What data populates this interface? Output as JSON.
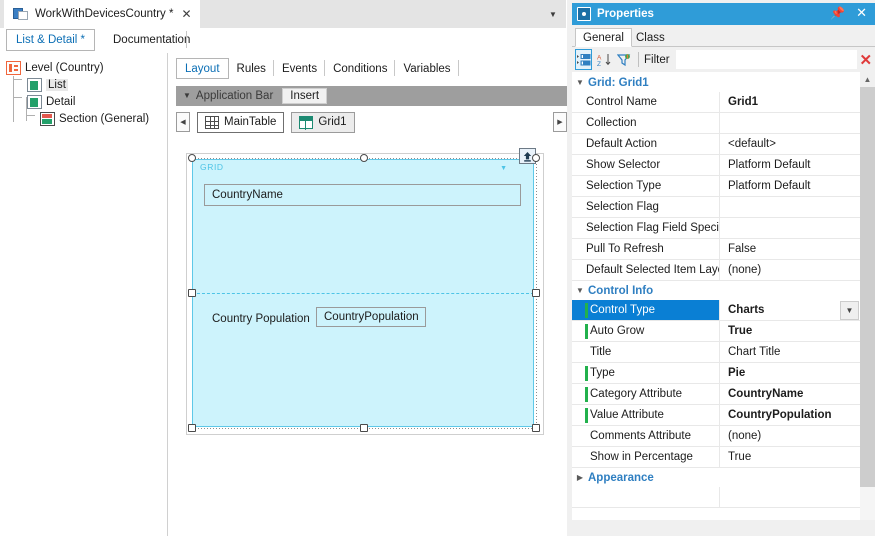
{
  "document": {
    "tab_title": "WorkWithDevicesCountry *",
    "tab_icon": "object-icon",
    "close_icon": "close-icon",
    "overflow_icon": "chevron-down-icon",
    "subtabs": [
      {
        "label": "List & Detail *",
        "active": true
      },
      {
        "label": "Documentation",
        "active": false
      }
    ]
  },
  "tree": {
    "nodes": [
      {
        "label": "Level (Country)",
        "icon": "level-icon",
        "selected": false
      },
      {
        "label": "List",
        "icon": "document-icon",
        "selected": true
      },
      {
        "label": "Detail",
        "icon": "document-icon",
        "selected": false
      },
      {
        "label": "Section (General)",
        "icon": "section-icon",
        "selected": false
      }
    ]
  },
  "editor": {
    "tabs": [
      {
        "label": "Layout",
        "active": true
      },
      {
        "label": "Rules",
        "active": false
      },
      {
        "label": "Events",
        "active": false
      },
      {
        "label": "Conditions",
        "active": false
      },
      {
        "label": "Variables",
        "active": false
      }
    ],
    "application_bar": {
      "caret_icon": "caret-down-icon",
      "label": "Application Bar",
      "insert_label": "Insert"
    },
    "breadcrumb": {
      "left_arrow_icon": "caret-left-icon",
      "right_arrow_icon": "caret-right-icon",
      "items": [
        {
          "label": "MainTable",
          "icon": "table-icon",
          "current": false
        },
        {
          "label": "Grid1",
          "icon": "grid-icon",
          "current": true
        }
      ]
    },
    "canvas": {
      "grid_label": "GRID",
      "grid_caret_icon": "caret-down-icon",
      "move_up_icon": "arrow-up-icon",
      "first_row_field": "CountryName",
      "second_row_label": "Country Population",
      "second_row_field": "CountryPopulation"
    }
  },
  "properties": {
    "title": "Properties",
    "title_icon": "gear-icon",
    "pin_icon": "pin-icon",
    "close_icon": "close-icon",
    "tabs": [
      {
        "label": "General",
        "active": true
      },
      {
        "label": "Class",
        "active": false
      }
    ],
    "toolbar": {
      "categorized_icon": "categorized-view-icon",
      "sort_icon": "sort-alpha-icon",
      "filter_toggle_icon": "funnel-icon",
      "filter_label": "Filter",
      "filter_value": "",
      "filter_placeholder": "",
      "clear_icon": "close-icon"
    },
    "scrollbar": {
      "up_icon": "chevron-up-icon"
    },
    "sections": [
      {
        "name": "Grid: Grid1",
        "expanded": true,
        "chevron_icon": "chevron-down-icon",
        "rows": [
          {
            "name": "Control Name",
            "value": "Grid1",
            "bold": true,
            "marked": false,
            "selected": false
          },
          {
            "name": "Collection",
            "value": "",
            "bold": false,
            "marked": false,
            "selected": false
          },
          {
            "name": "Default Action",
            "value": "<default>",
            "bold": false,
            "marked": false,
            "selected": false
          },
          {
            "name": "Show Selector",
            "value": "Platform Default",
            "bold": false,
            "marked": false,
            "selected": false
          },
          {
            "name": "Selection Type",
            "value": "Platform Default",
            "bold": false,
            "marked": false,
            "selected": false
          },
          {
            "name": "Selection Flag",
            "value": "",
            "bold": false,
            "marked": false,
            "selected": false
          },
          {
            "name": "Selection Flag Field Specifie",
            "value": "",
            "bold": false,
            "marked": false,
            "selected": false
          },
          {
            "name": "Pull To Refresh",
            "value": "False",
            "bold": false,
            "marked": false,
            "selected": false
          },
          {
            "name": "Default Selected Item Layou",
            "value": "(none)",
            "bold": false,
            "marked": false,
            "selected": false
          }
        ]
      },
      {
        "name": "Control Info",
        "expanded": true,
        "chevron_icon": "chevron-down-icon",
        "rows": [
          {
            "name": "Control Type",
            "value": "Charts",
            "bold": true,
            "marked": true,
            "selected": true,
            "dropdown": true,
            "dropdown_icon": "chevron-down-icon"
          },
          {
            "name": "Auto Grow",
            "value": "True",
            "bold": true,
            "marked": true,
            "selected": false
          },
          {
            "name": "Title",
            "value": "Chart Title",
            "bold": false,
            "marked": false,
            "selected": false
          },
          {
            "name": "Type",
            "value": "Pie",
            "bold": true,
            "marked": true,
            "selected": false
          },
          {
            "name": "Category Attribute",
            "value": "CountryName",
            "bold": true,
            "marked": true,
            "selected": false
          },
          {
            "name": "Value Attribute",
            "value": "CountryPopulation",
            "bold": true,
            "marked": true,
            "selected": false
          },
          {
            "name": "Comments Attribute",
            "value": "(none)",
            "bold": false,
            "marked": false,
            "selected": false
          },
          {
            "name": "Show in Percentage",
            "value": "True",
            "bold": false,
            "marked": false,
            "selected": false
          }
        ]
      },
      {
        "name": "Appearance",
        "expanded": false,
        "chevron_icon": "chevron-right-icon",
        "rows": []
      }
    ]
  },
  "colors": {
    "accent_blue": "#2f9cd8",
    "selection_blue": "#0a7fd4",
    "canvas_cyan": "#cdf3fc",
    "canvas_border": "#5ec8e8",
    "group_header": "#2f7fc1",
    "marker_green": "#22b14c",
    "appbar_gray": "#9e9e9e",
    "clear_red": "#e03a3a"
  }
}
